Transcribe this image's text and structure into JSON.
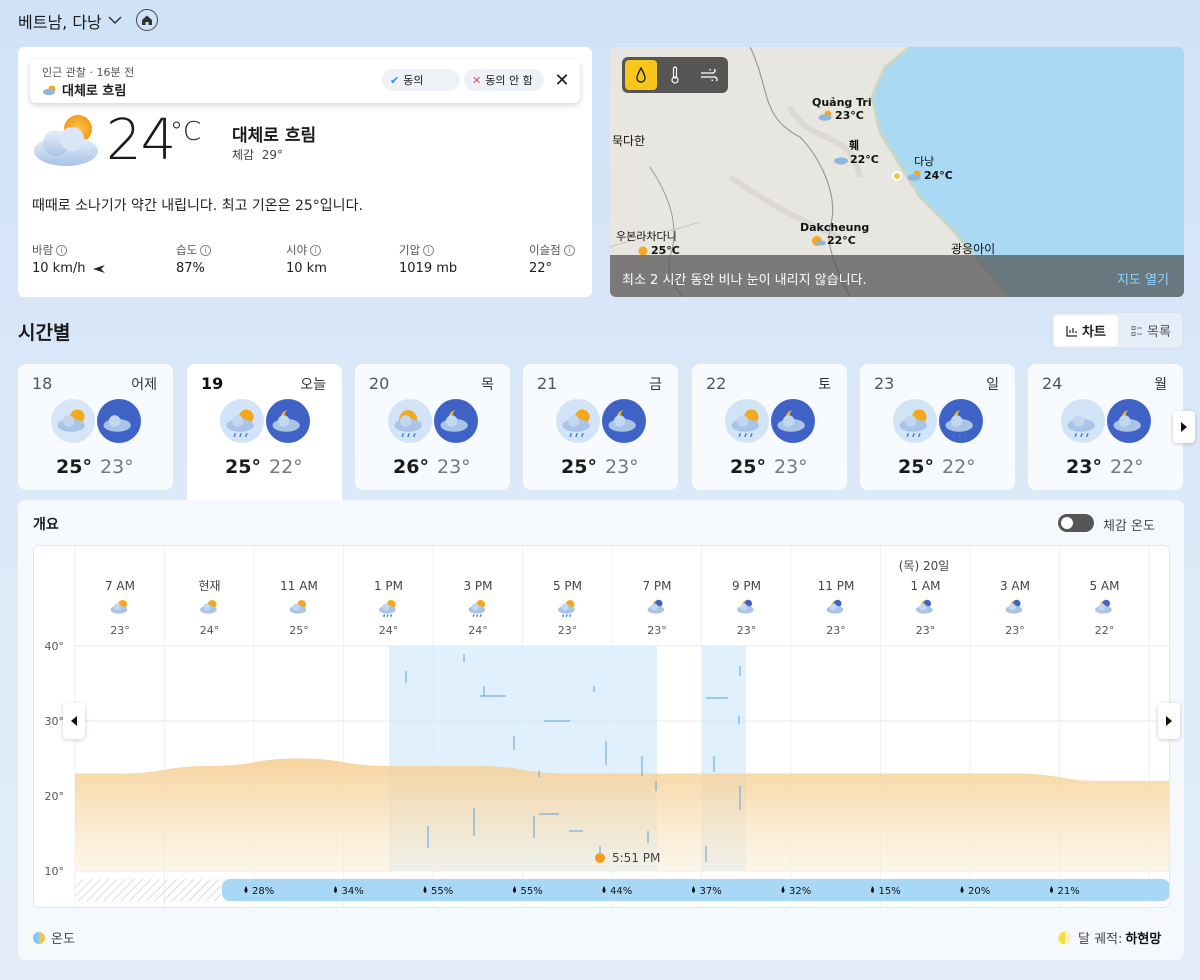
{
  "location": {
    "name": "베트남, 다낭"
  },
  "observation": {
    "source_line": "인근 관찰 · 16분 전",
    "condition": "대체로 흐림",
    "agree_label": "동의",
    "disagree_label": "동의 안 함"
  },
  "current": {
    "temp": "24",
    "unit": "°C",
    "condition": "대체로 흐림",
    "feels_label": "체감",
    "feels_value": "29°",
    "summary": "때때로 소나기가 약간 내립니다. 최고 기온은 25°입니다.",
    "details": [
      {
        "label": "바람",
        "value": "10 km/h"
      },
      {
        "label": "습도",
        "value": "87%"
      },
      {
        "label": "시야",
        "value": "10 km"
      },
      {
        "label": "기압",
        "value": "1019 mb"
      },
      {
        "label": "이슬점",
        "value": "22°"
      }
    ]
  },
  "map": {
    "cities": [
      {
        "name": "Quảng Tri",
        "temp": "23°C"
      },
      {
        "name": "훼",
        "temp": "22°C"
      },
      {
        "name": "다낭",
        "temp": "24°C"
      },
      {
        "name": "Dakcheung",
        "temp": "22°C"
      },
      {
        "name": "우본라차다니",
        "temp": "25°C"
      }
    ],
    "labels": [
      "묵다한",
      "광응아이"
    ],
    "message": "최소 2 시간 동안 비나 눈이 내리지 않습니다.",
    "open_label": "지도 열기"
  },
  "hourly": {
    "title": "시간별",
    "chart_label": "차트",
    "list_label": "목록"
  },
  "days": [
    {
      "num": "18",
      "name": "어제",
      "hi": "25°",
      "lo": "23°",
      "icons": [
        "partly-cloudy-day-icon",
        "cloudy-night-icon"
      ]
    },
    {
      "num": "19",
      "name": "오늘",
      "hi": "25°",
      "lo": "22°",
      "icons": [
        "showers-day-icon",
        "partly-cloudy-night-icon"
      ]
    },
    {
      "num": "20",
      "name": "목",
      "hi": "26°",
      "lo": "23°",
      "icons": [
        "rain-sun-icon",
        "partly-cloudy-night-icon"
      ]
    },
    {
      "num": "21",
      "name": "금",
      "hi": "25°",
      "lo": "23°",
      "icons": [
        "showers-day-icon",
        "partly-cloudy-night-icon"
      ]
    },
    {
      "num": "22",
      "name": "토",
      "hi": "25°",
      "lo": "23°",
      "icons": [
        "showers-day-icon",
        "partly-cloudy-night-icon"
      ]
    },
    {
      "num": "23",
      "name": "일",
      "hi": "25°",
      "lo": "22°",
      "icons": [
        "showers-day-icon",
        "rain-night-icon"
      ]
    },
    {
      "num": "24",
      "name": "월",
      "hi": "23°",
      "lo": "22°",
      "icons": [
        "rain-icon",
        "partly-cloudy-night-icon"
      ]
    }
  ],
  "overview": {
    "title": "개요",
    "feels_toggle_label": "체감 온도",
    "next_day_label": "(목) 20일",
    "sunset_label": "5:51 PM",
    "legend_temp": "온도",
    "legend_moon_label": "달 궤적:",
    "legend_moon_value": "하현망"
  },
  "chart_data": {
    "type": "area",
    "x": [
      "7 AM",
      "현재",
      "11 AM",
      "1 PM",
      "3 PM",
      "5 PM",
      "7 PM",
      "9 PM",
      "11 PM",
      "1 AM",
      "3 AM",
      "5 AM"
    ],
    "temps": [
      23,
      24,
      25,
      24,
      24,
      23,
      23,
      23,
      23,
      23,
      23,
      22
    ],
    "temp_labels": [
      "23°",
      "24°",
      "25°",
      "24°",
      "24°",
      "23°",
      "23°",
      "23°",
      "23°",
      "23°",
      "23°",
      "22°"
    ],
    "icons": [
      "partly-cloudy-day-icon",
      "partly-cloudy-day-icon",
      "partly-cloudy-day-icon",
      "showers-day-icon",
      "showers-day-icon",
      "showers-day-icon",
      "partly-cloudy-night-icon",
      "partly-cloudy-night-icon",
      "partly-cloudy-night-icon",
      "partly-cloudy-night-icon",
      "partly-cloudy-night-icon",
      "partly-cloudy-night-icon"
    ],
    "precip": [
      "28%",
      "34%",
      "55%",
      "55%",
      "44%",
      "37%",
      "32%",
      "15%",
      "20%",
      "21%"
    ],
    "yticks": [
      "40°",
      "30°",
      "20°",
      "10°"
    ],
    "ylim": [
      10,
      40
    ],
    "colors": {
      "temp_fill": "#f5cf95",
      "rain_band": "#d6ebfb",
      "precip_bar": "#a9d8f7"
    }
  }
}
